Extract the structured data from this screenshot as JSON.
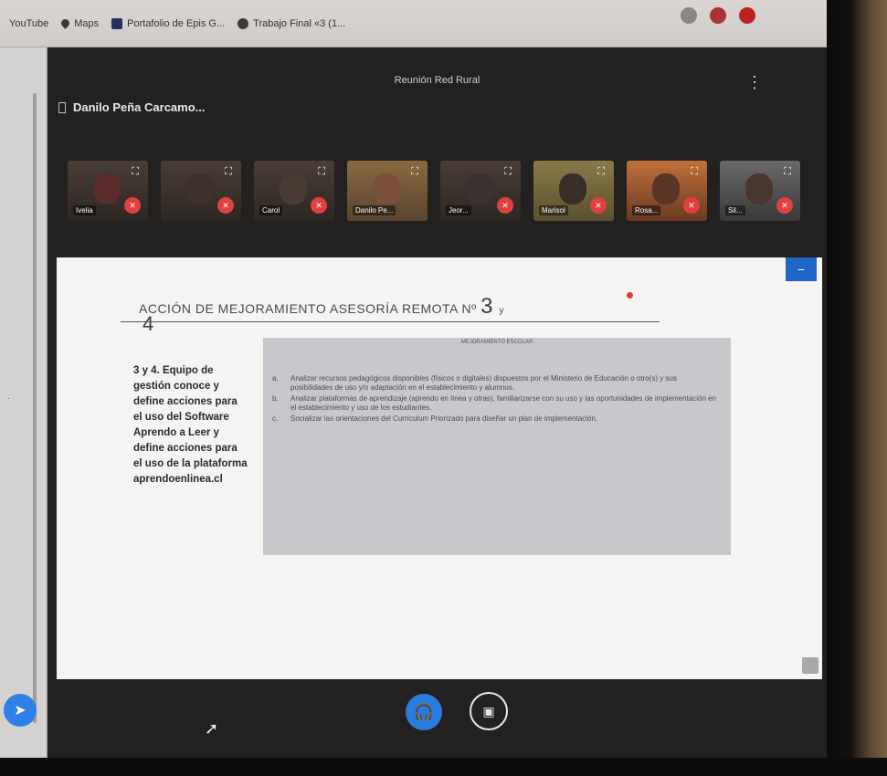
{
  "bookmarks": [
    {
      "label": "YouTube",
      "icon": "youtube-icon",
      "color": "#d8d4d0"
    },
    {
      "label": "Maps",
      "icon": "map-pin-icon",
      "color": "#2a2a2a"
    },
    {
      "label": "Portafolio de Epis G...",
      "icon": "slides-icon",
      "color": "#24305e"
    },
    {
      "label": "Trabajo Final «3 (1...",
      "icon": "globe-icon",
      "color": "#3b3b3b"
    }
  ],
  "meeting": {
    "title": "Reunión Red Rural",
    "presenter": "Danilo Peña Carcamo..."
  },
  "participants": [
    {
      "name": "Ivelia"
    },
    {
      "name": ""
    },
    {
      "name": "Carol"
    },
    {
      "name": "Danilo Pe..."
    },
    {
      "name": "Jeor..."
    },
    {
      "name": "Marisol"
    },
    {
      "name": "Rosa..."
    },
    {
      "name": "Sil..."
    }
  ],
  "slide": {
    "title": "ACCIÓN DE MEJORAMIENTO ASESORÍA REMOTA Nº",
    "title_num": "3",
    "title_y": "y",
    "title_num2": "4",
    "left_text": "3 y 4. Equipo de gestión conoce y define acciones para el uso del Software Aprendo a Leer y define acciones para el uso de la plataforma aprendoenlinea.cl",
    "box_header": "MEJORAMIENTO ESCOLAR",
    "items": [
      {
        "marker": "a.",
        "text": "Analizar recursos pedagógicos disponibles (físicos o digitales) dispuestos por el Ministerio de Educación o otro(s) y sus posibilidades de uso y/o adaptación en el establecimiento y alumnos."
      },
      {
        "marker": "b.",
        "text": "Analizar plataformas de aprendizaje (aprendo en línea y otras), familiarizarse con su uso y las oportunidades de implementación en el establecimiento y uso de los estudiantes."
      },
      {
        "marker": "c.",
        "text": "Socializar las orientaciones del Currículum Priorizado para diseñar un plan de implementación."
      }
    ]
  },
  "colors": {
    "accent_blue": "#2a7be0",
    "mic_muted_red": "#e0413f"
  }
}
